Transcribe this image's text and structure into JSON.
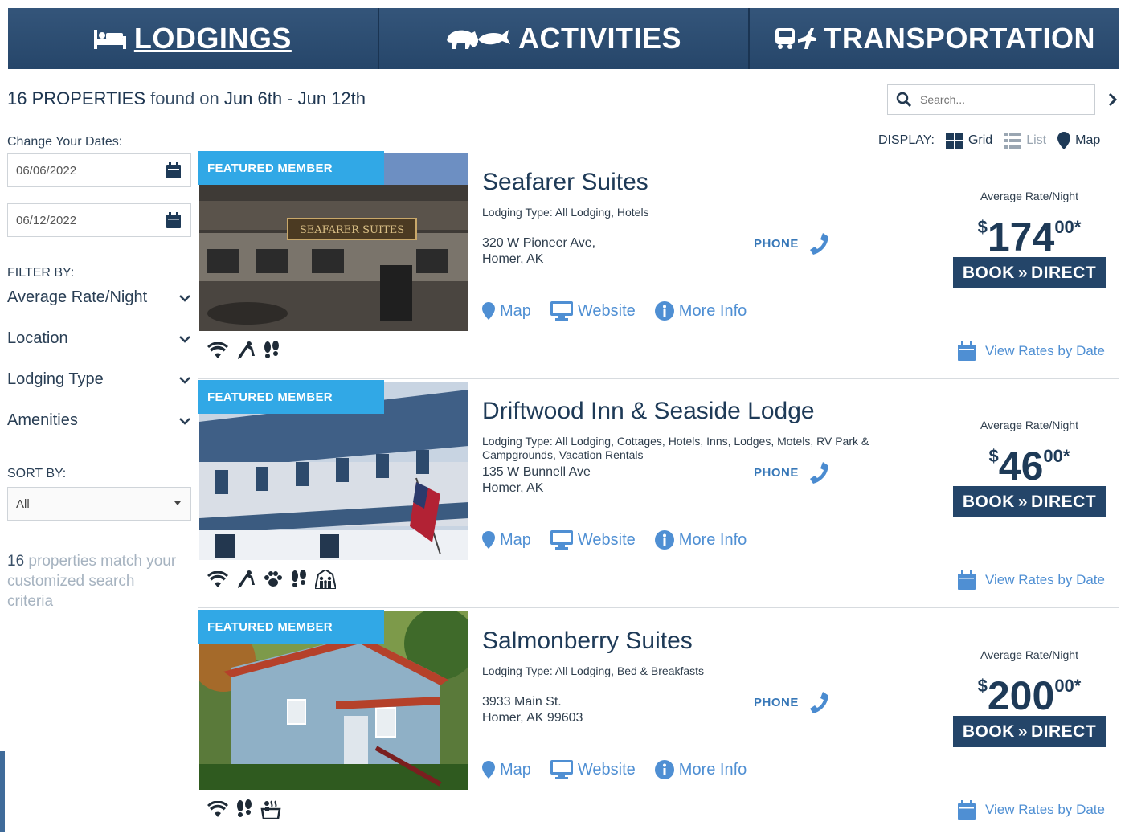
{
  "nav": {
    "tabs": [
      {
        "label": "LODGINGS",
        "icon": "bed-icon",
        "active": true
      },
      {
        "label": "ACTIVITIES",
        "icon": "animals-icon",
        "active": false
      },
      {
        "label": "TRANSPORTATION",
        "icon": "bus-plane-icon",
        "active": false
      }
    ]
  },
  "results": {
    "count_text": "16 PROPERTIES",
    "found_on": "found on",
    "dates": "Jun 6th - Jun 12th"
  },
  "search": {
    "placeholder": "Search..."
  },
  "display": {
    "label": "DISPLAY:",
    "grid": "Grid",
    "list": "List",
    "map": "Map"
  },
  "sidebar": {
    "change_dates_label": "Change Your Dates:",
    "start_date": "06/06/2022",
    "end_date": "06/12/2022",
    "filter_label": "FILTER BY:",
    "filters": [
      "Average Rate/Night",
      "Location",
      "Lodging Type",
      "Amenities"
    ],
    "sort_label": "SORT BY:",
    "sort_value": "All",
    "match_count": "16",
    "match_text": " properties match your customized search criteria"
  },
  "common": {
    "featured": "FEATURED MEMBER",
    "phone": "PHONE",
    "map": "Map",
    "website": "Website",
    "more_info": "More Info",
    "rate_label": "Average Rate/Night",
    "book_left": "BOOK",
    "book_arrows": "»",
    "book_right": "DIRECT",
    "view_rates": "View Rates by Date"
  },
  "listings": [
    {
      "name": "Seafarer Suites",
      "type": "Lodging Type: All Lodging, Hotels",
      "address1": "320 W Pioneer Ave,",
      "address2": "Homer, AK",
      "price_dollar": "$",
      "price_whole": "174",
      "price_cents": "00*",
      "amenities": [
        "wifi-icon",
        "ski-icon",
        "footprints-icon"
      ],
      "sign_text": "SEAFARER SUITES"
    },
    {
      "name": "Driftwood Inn & Seaside Lodge",
      "type": "Lodging Type: All Lodging, Cottages, Hotels, Inns, Lodges, Motels, RV Park & Campgrounds, Vacation Rentals",
      "address1": "135 W Bunnell Ave",
      "address2": "Homer, AK",
      "price_dollar": "$",
      "price_whole": "46",
      "price_cents": "00*",
      "amenities": [
        "wifi-icon",
        "ski-icon",
        "paw-icon",
        "footprints-icon",
        "family-icon"
      ]
    },
    {
      "name": "Salmonberry Suites",
      "type": "Lodging Type: All Lodging, Bed & Breakfasts",
      "address1": "3933 Main St.",
      "address2": "Homer, AK 99603",
      "price_dollar": "$",
      "price_whole": "200",
      "price_cents": "00*",
      "amenities": [
        "wifi-icon",
        "footprints-icon",
        "hot-tub-icon"
      ]
    }
  ],
  "colors": {
    "nav_bg": "#2c4b6e",
    "featured": "#31a8e6",
    "link": "#4f8fd3",
    "book_btn": "#244569"
  }
}
